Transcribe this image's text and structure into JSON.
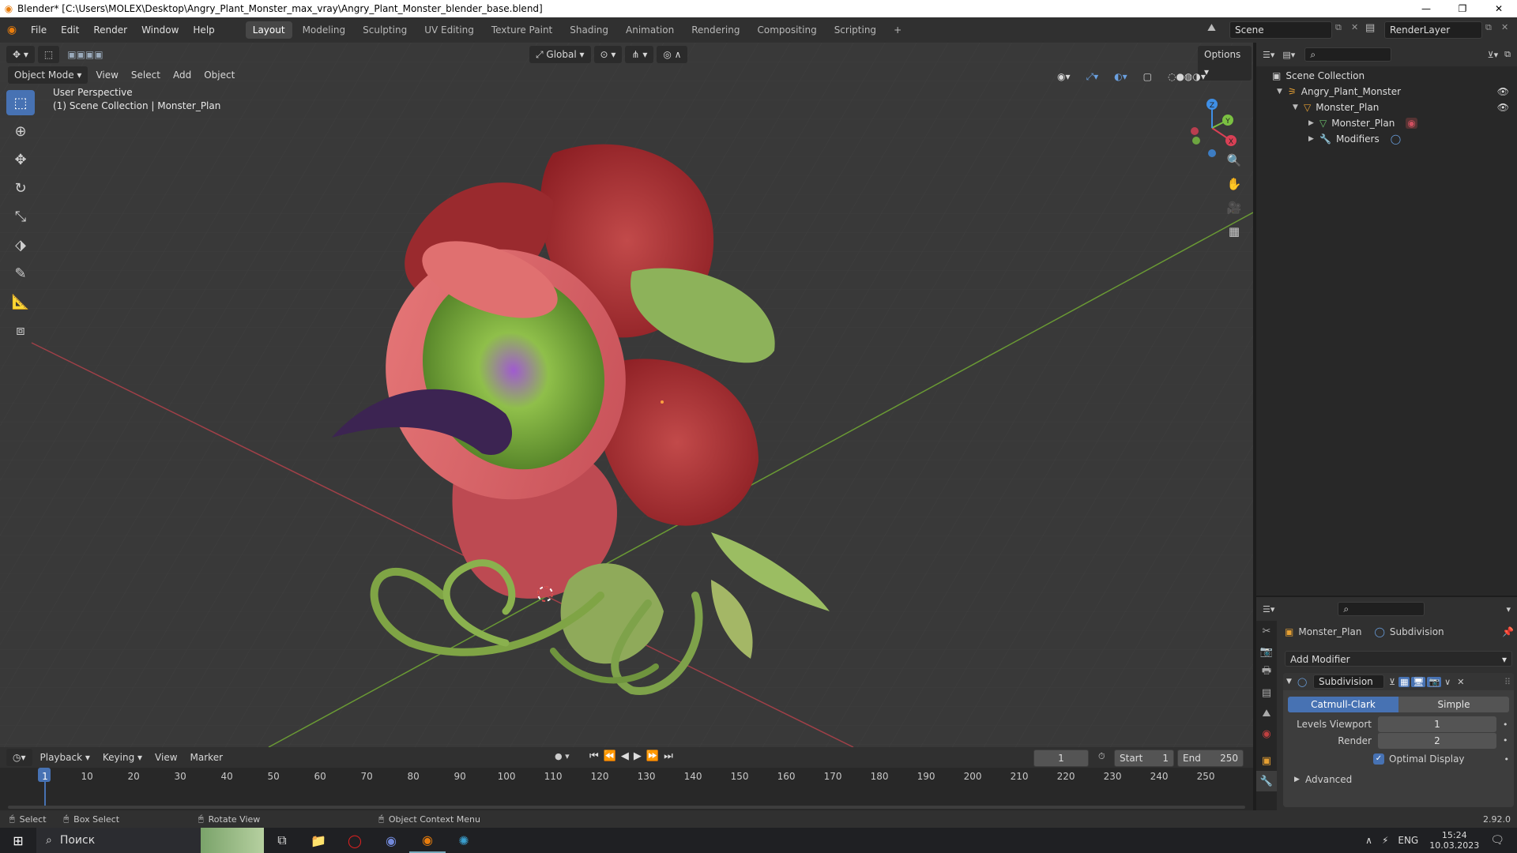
{
  "window": {
    "title": "Blender* [C:\\Users\\MOLEX\\Desktop\\Angry_Plant_Monster_max_vray\\Angry_Plant_Monster_blender_base.blend]",
    "minimize": "—",
    "maximize": "❐",
    "close": "✕"
  },
  "menu": {
    "items": [
      "File",
      "Edit",
      "Render",
      "Window",
      "Help"
    ],
    "workspaces": [
      "Layout",
      "Modeling",
      "Sculpting",
      "UV Editing",
      "Texture Paint",
      "Shading",
      "Animation",
      "Rendering",
      "Compositing",
      "Scripting"
    ],
    "add_workspace": "+",
    "scene": "Scene",
    "render_layer": "RenderLayer"
  },
  "viewport": {
    "mode": "Object Mode",
    "menus": [
      "View",
      "Select",
      "Add",
      "Object"
    ],
    "transform_orientation": "Global",
    "options": "Options",
    "perspective": "User Perspective",
    "collection_info": "(1) Scene Collection | Monster_Plan",
    "gizmo_axes": [
      "X",
      "Y",
      "Z"
    ]
  },
  "outliner": {
    "root": "Scene Collection",
    "rows": [
      {
        "label": "Angry_Plant_Monster",
        "indent": 1
      },
      {
        "label": "Monster_Plan",
        "indent": 2
      },
      {
        "label": "Monster_Plan",
        "indent": 3
      },
      {
        "label": "Modifiers",
        "indent": 3
      }
    ]
  },
  "properties": {
    "object_name": "Monster_Plan",
    "modifier_crumb": "Subdivision",
    "add_modifier": "Add Modifier",
    "modifier": {
      "name": "Subdivision",
      "type_catmull": "Catmull-Clark",
      "type_simple": "Simple",
      "levels_viewport_label": "Levels Viewport",
      "levels_viewport": "1",
      "render_label": "Render",
      "render": "2",
      "optimal_display": "Optimal Display",
      "optimal_display_checked": true,
      "advanced": "Advanced"
    }
  },
  "timeline": {
    "menus": [
      "Playback",
      "Keying",
      "View",
      "Marker"
    ],
    "current_frame": "1",
    "start_label": "Start",
    "start": "1",
    "end_label": "End",
    "end": "250",
    "ticks": [
      "1",
      "10",
      "20",
      "30",
      "40",
      "50",
      "60",
      "70",
      "80",
      "90",
      "100",
      "110",
      "120",
      "130",
      "140",
      "150",
      "160",
      "170",
      "180",
      "190",
      "200",
      "210",
      "220",
      "230",
      "240",
      "250"
    ]
  },
  "statusbar": {
    "select": "Select",
    "box_select": "Box Select",
    "rotate_view": "Rotate View",
    "context_menu": "Object Context Menu",
    "version": "2.92.0"
  },
  "taskbar": {
    "search": "Поиск",
    "lang": "ENG",
    "time": "15:24",
    "date": "10.03.2023"
  },
  "colors": {
    "accent": "#4772b3",
    "x_axis": "#d94055",
    "y_axis": "#7bc142",
    "z_axis": "#3f8fe6"
  }
}
